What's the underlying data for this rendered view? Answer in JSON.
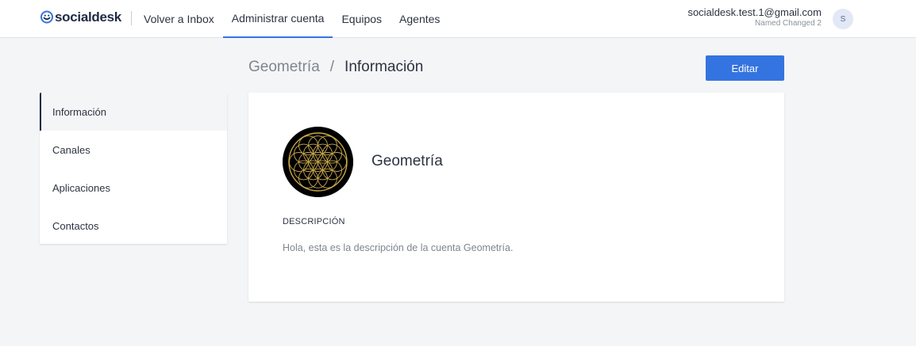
{
  "header": {
    "logo_text": "socialdesk",
    "nav": [
      {
        "label": "Volver a Inbox"
      },
      {
        "label": "Administrar cuenta"
      },
      {
        "label": "Equipos"
      },
      {
        "label": "Agentes"
      }
    ],
    "active_nav": "Administrar cuenta",
    "user": {
      "email": "socialdesk.test.1@gmail.com",
      "name": "Named Changed 2",
      "avatar_initial": "S"
    }
  },
  "breadcrumb": {
    "parent": "Geometría",
    "separator": "/",
    "current": "Información"
  },
  "actions": {
    "edit_label": "Editar"
  },
  "sidebar": {
    "items": [
      {
        "label": "Información"
      },
      {
        "label": "Canales"
      },
      {
        "label": "Aplicaciones"
      },
      {
        "label": "Contactos"
      }
    ],
    "active_item": "Información"
  },
  "account": {
    "name": "Geometría",
    "avatar_icon": "flower-of-life-icon",
    "description_label": "DESCRIPCIÓN",
    "description": "Hola, esta es la descripción de la cuenta Geometría."
  },
  "colors": {
    "accent": "#3474e0",
    "logo": "#1f2a44",
    "background": "#f4f5f7",
    "avatar_gold": "#c9a84c"
  }
}
